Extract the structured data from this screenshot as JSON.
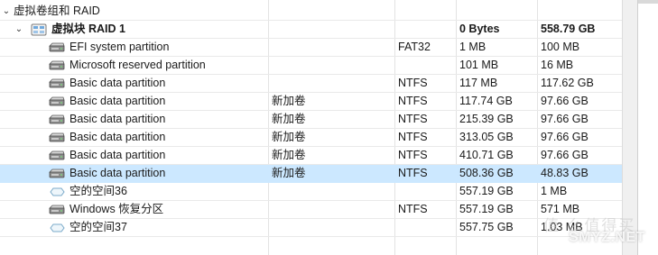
{
  "group_title": "虚拟卷组和 RAID",
  "raid": {
    "name": "虚拟块 RAID 1",
    "start": "0 Bytes",
    "size": "558.79 GB"
  },
  "partitions": [
    {
      "name": "EFI system partition",
      "label": "",
      "fs": "FAT32",
      "start": "1 MB",
      "size": "100 MB",
      "icon": "partition-disk-icon"
    },
    {
      "name": "Microsoft reserved partition",
      "label": "",
      "fs": "",
      "start": "101 MB",
      "size": "16 MB",
      "icon": "partition-disk-icon"
    },
    {
      "name": "Basic data partition",
      "label": "",
      "fs": "NTFS",
      "start": "117 MB",
      "size": "117.62 GB",
      "icon": "partition-disk-icon"
    },
    {
      "name": "Basic data partition",
      "label": "新加卷",
      "fs": "NTFS",
      "start": "117.74 GB",
      "size": "97.66 GB",
      "icon": "partition-disk-icon"
    },
    {
      "name": "Basic data partition",
      "label": "新加卷",
      "fs": "NTFS",
      "start": "215.39 GB",
      "size": "97.66 GB",
      "icon": "partition-disk-icon"
    },
    {
      "name": "Basic data partition",
      "label": "新加卷",
      "fs": "NTFS",
      "start": "313.05 GB",
      "size": "97.66 GB",
      "icon": "partition-disk-icon"
    },
    {
      "name": "Basic data partition",
      "label": "新加卷",
      "fs": "NTFS",
      "start": "410.71 GB",
      "size": "97.66 GB",
      "icon": "partition-disk-icon"
    },
    {
      "name": "Basic data partition",
      "label": "新加卷",
      "fs": "NTFS",
      "start": "508.36 GB",
      "size": "48.83 GB",
      "icon": "partition-disk-icon",
      "selected": true
    },
    {
      "name": "空的空间36",
      "label": "",
      "fs": "",
      "start": "557.19 GB",
      "size": "1 MB",
      "icon": "free-space-icon"
    },
    {
      "name": "Windows 恢复分区",
      "label": "",
      "fs": "NTFS",
      "start": "557.19 GB",
      "size": "571 MB",
      "icon": "partition-disk-icon"
    },
    {
      "name": "空的空间37",
      "label": "",
      "fs": "",
      "start": "557.75 GB",
      "size": "1.03 MB",
      "icon": "free-space-icon"
    }
  ],
  "watermark": {
    "chars": "值 么值得买",
    "text": "SMYZ.NET"
  },
  "colors": {
    "selection": "#cce8ff",
    "grid": "#e3e3e3"
  }
}
